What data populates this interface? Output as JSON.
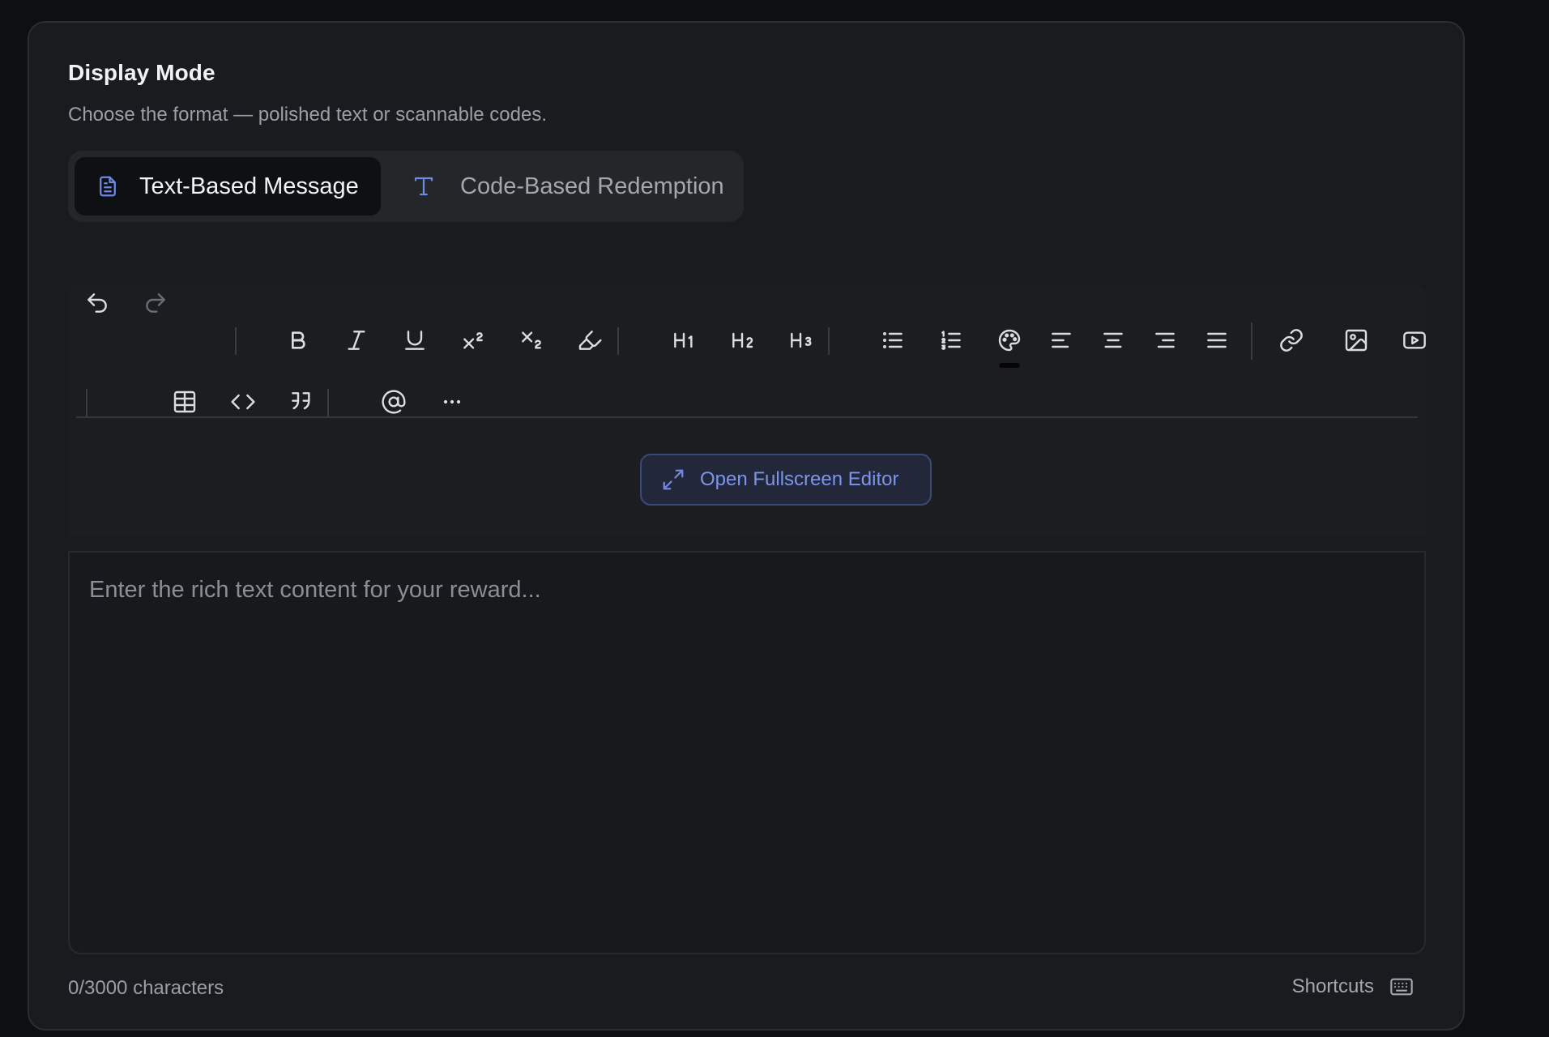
{
  "section": {
    "title": "Display Mode",
    "subtitle": "Choose the format — polished text or scannable codes."
  },
  "mode_selector": {
    "options": [
      {
        "label": "Text-Based Message",
        "icon": "document-icon",
        "selected": true
      },
      {
        "label": "Code-Based Redemption",
        "icon": "text-type-icon",
        "selected": false
      }
    ],
    "accent_color": "#6f8ae6"
  },
  "toolbar": {
    "buttons": [
      {
        "name": "undo",
        "enabled": true
      },
      {
        "name": "redo",
        "enabled": false
      },
      {
        "name": "bold",
        "enabled": true
      },
      {
        "name": "italic",
        "enabled": true
      },
      {
        "name": "underline",
        "enabled": true
      },
      {
        "name": "superscript",
        "enabled": true
      },
      {
        "name": "subscript",
        "enabled": true
      },
      {
        "name": "highlight",
        "enabled": true
      },
      {
        "name": "heading-1",
        "label": "H1"
      },
      {
        "name": "heading-2",
        "label": "H2"
      },
      {
        "name": "heading-3",
        "label": "H3"
      },
      {
        "name": "bullet-list"
      },
      {
        "name": "ordered-list"
      },
      {
        "name": "text-color"
      },
      {
        "name": "align-left"
      },
      {
        "name": "align-center"
      },
      {
        "name": "align-right"
      },
      {
        "name": "align-justify"
      },
      {
        "name": "link"
      },
      {
        "name": "image"
      },
      {
        "name": "video"
      },
      {
        "name": "table"
      },
      {
        "name": "code"
      },
      {
        "name": "quote"
      },
      {
        "name": "mention"
      },
      {
        "name": "more"
      }
    ],
    "fullscreen_label": "Open Fullscreen Editor"
  },
  "editor": {
    "placeholder": "Enter the rich text content for your reward...",
    "value": ""
  },
  "footer": {
    "char_count": "0/3000 characters",
    "shortcuts_label": "Shortcuts"
  }
}
